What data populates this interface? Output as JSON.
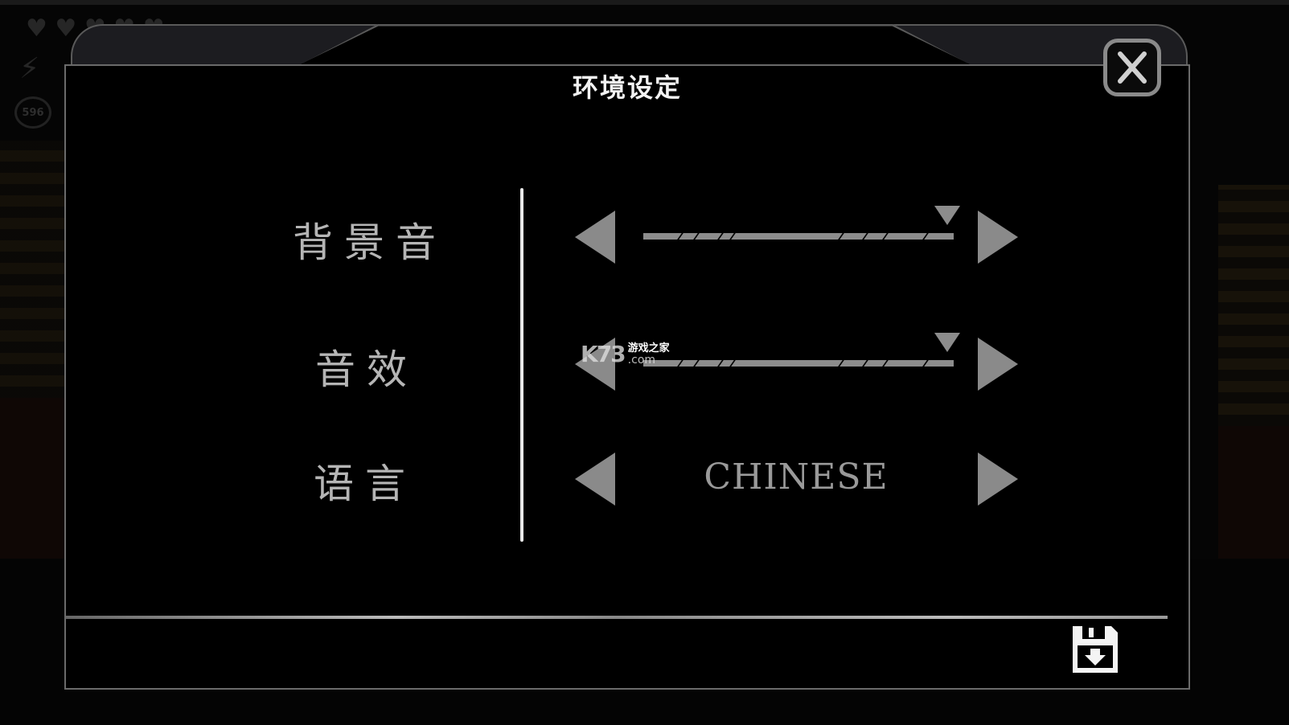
{
  "hud": {
    "hearts": "♥ ♥ ♥ ♥ ♥",
    "bolt": "⚡",
    "coins": "596"
  },
  "dialog": {
    "title": "环境设定",
    "close_icon": "close-icon"
  },
  "settings": [
    {
      "label": "背景音",
      "type": "slider",
      "value_percent": 98
    },
    {
      "label": "音效",
      "type": "slider",
      "value_percent": 98
    },
    {
      "label": "语言",
      "type": "selector",
      "value": "CHINESE"
    }
  ],
  "footer": {
    "save_icon": "save-icon"
  },
  "watermark": {
    "logo": "K73",
    "cn": "游戏之家",
    "domain": ".com"
  },
  "colors": {
    "panel_bg": "#000000",
    "panel_border": "#6a6a6a",
    "control_gray": "#8c8c8c",
    "title_text": "#f2f2f2",
    "label_text": "#b5b5b5"
  }
}
